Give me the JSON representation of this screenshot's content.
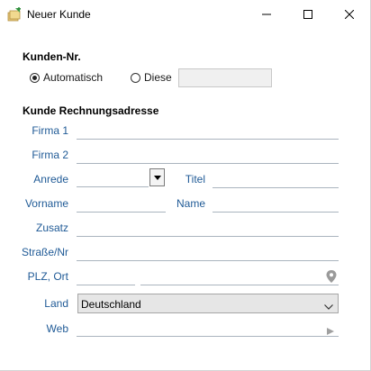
{
  "window": {
    "title": "Neuer Kunde"
  },
  "customer_number": {
    "heading": "Kunden-Nr.",
    "option_auto": "Automatisch",
    "option_this": "Diese",
    "selected": "Automatisch",
    "value": ""
  },
  "billing_address": {
    "heading": "Kunde Rechnungsadresse",
    "firma1_label": "Firma 1",
    "firma2_label": "Firma 2",
    "anrede_label": "Anrede",
    "titel_label": "Titel",
    "vorname_label": "Vorname",
    "name_label": "Name",
    "zusatz_label": "Zusatz",
    "strasse_label": "Straße/Nr",
    "plz_label": "PLZ, Ort",
    "land_label": "Land",
    "land_value": "Deutschland",
    "web_label": "Web"
  },
  "icons": {
    "app": "customer-add-icon",
    "minimize": "minimize-icon",
    "maximize": "maximize-icon",
    "close": "close-icon",
    "location": "map-pin-icon",
    "web_go": "play-arrow-icon"
  },
  "colors": {
    "label": "#1f5a96",
    "line": "#aab4be",
    "select_bg": "#e6e6e6"
  }
}
